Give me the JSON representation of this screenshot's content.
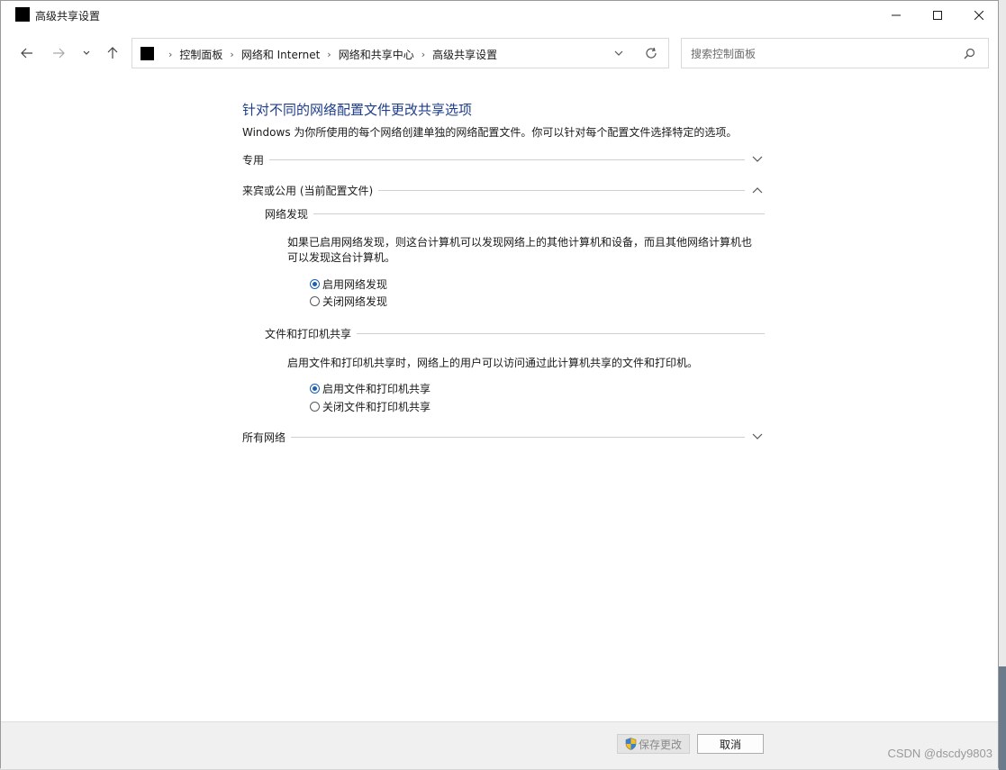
{
  "window": {
    "title": "高级共享设置",
    "minimize_icon": "minimize-icon",
    "maximize_icon": "maximize-icon",
    "close_icon": "close-icon"
  },
  "nav": {
    "back_icon": "arrow-left-icon",
    "forward_icon": "arrow-right-icon",
    "recent_icon": "chevron-down-icon",
    "up_icon": "arrow-up-icon",
    "breadcrumbs": [
      "控制面板",
      "网络和 Internet",
      "网络和共享中心",
      "高级共享设置"
    ],
    "search_placeholder": "搜索控制面板"
  },
  "main": {
    "heading": "针对不同的网络配置文件更改共享选项",
    "intro": "Windows 为你所使用的每个网络创建单独的网络配置文件。你可以针对每个配置文件选择特定的选项。",
    "private_label": "专用",
    "guest_label": "来宾或公用 (当前配置文件)",
    "discovery": {
      "title": "网络发现",
      "desc": "如果已启用网络发现，则这台计算机可以发现网络上的其他计算机和设备，而且其他网络计算机也可以发现这台计算机。",
      "on_label": "启用网络发现",
      "off_label": "关闭网络发现",
      "selected": "on"
    },
    "sharing": {
      "title": "文件和打印机共享",
      "desc": "启用文件和打印机共享时，网络上的用户可以访问通过此计算机共享的文件和打印机。",
      "on_label": "启用文件和打印机共享",
      "off_label": "关闭文件和打印机共享",
      "selected": "on"
    },
    "all_networks_label": "所有网络"
  },
  "footer": {
    "save_label": "保存更改",
    "cancel_label": "取消"
  },
  "watermark": "CSDN @dscdy9803",
  "colors": {
    "heading": "#1e3d8a",
    "radio_selected": "#1c5fb4",
    "footer_bg": "#f0f0f0"
  }
}
